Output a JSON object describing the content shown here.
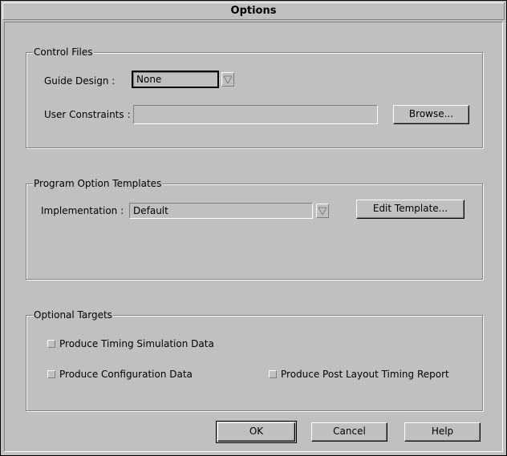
{
  "window": {
    "title": "Options"
  },
  "control_files": {
    "legend": "Control Files",
    "guide_design": {
      "label": "Guide Design :",
      "value": "None"
    },
    "user_constraints": {
      "label": "User Constraints :",
      "value": ""
    },
    "browse_label": "Browse..."
  },
  "templates": {
    "legend": "Program Option Templates",
    "implementation": {
      "label": "Implementation :",
      "value": "Default"
    },
    "edit_template_label": "Edit Template..."
  },
  "targets": {
    "legend": "Optional Targets",
    "timing_sim": {
      "label": "Produce Timing Simulation Data",
      "checked": false
    },
    "config": {
      "label": "Produce Configuration Data",
      "checked": false
    },
    "post_layout": {
      "label": "Produce Post Layout Timing Report",
      "checked": false
    }
  },
  "buttons": {
    "ok": "OK",
    "cancel": "Cancel",
    "help": "Help"
  },
  "icons": {
    "dropdown": "chevron-down-icon",
    "checkbox": "checkbox-icon"
  }
}
